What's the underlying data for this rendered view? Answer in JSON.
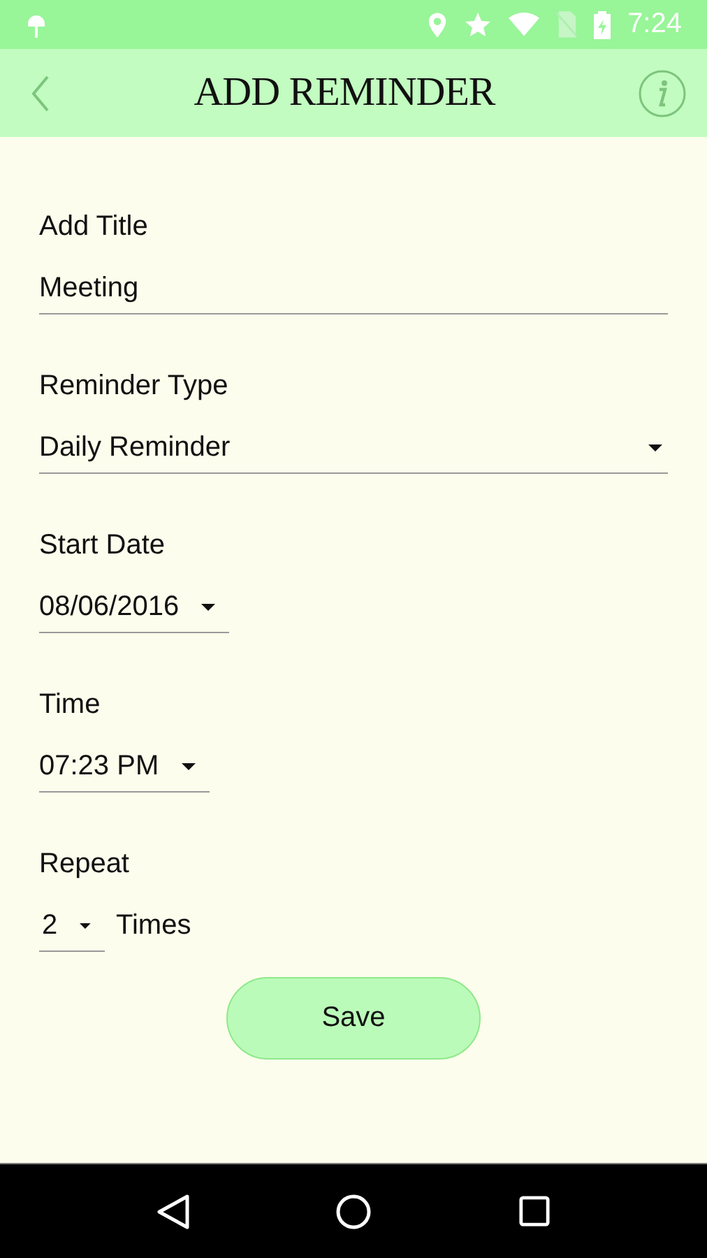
{
  "status_bar": {
    "time": "7:24"
  },
  "header": {
    "title": "ADD REMINDER"
  },
  "fields": [
    {
      "kind": "text",
      "label": "Add Title",
      "value": "Meeting"
    },
    {
      "kind": "select",
      "label": "Reminder Type",
      "value": "Daily Reminder"
    },
    {
      "kind": "picker",
      "label": "Start Date",
      "value": "08/06/2016"
    },
    {
      "kind": "picker",
      "label": "Time",
      "value": "07:23 PM"
    },
    {
      "kind": "repeat",
      "label": "Repeat",
      "value": "2",
      "suffix": "Times"
    }
  ],
  "save_button": {
    "label": "Save"
  }
}
